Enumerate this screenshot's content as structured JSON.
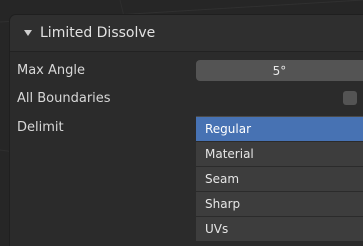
{
  "panel": {
    "title": "Limited Dissolve"
  },
  "properties": {
    "max_angle": {
      "label": "Max Angle",
      "value": "5°"
    },
    "all_boundaries": {
      "label": "All Boundaries",
      "checked": false
    },
    "delimit": {
      "label": "Delimit",
      "options": [
        "Regular",
        "Material",
        "Seam",
        "Sharp",
        "UVs"
      ],
      "selected": "Regular"
    }
  },
  "colors": {
    "selected_option": "#4772b3",
    "panel_bg": "#2b2b2b"
  }
}
